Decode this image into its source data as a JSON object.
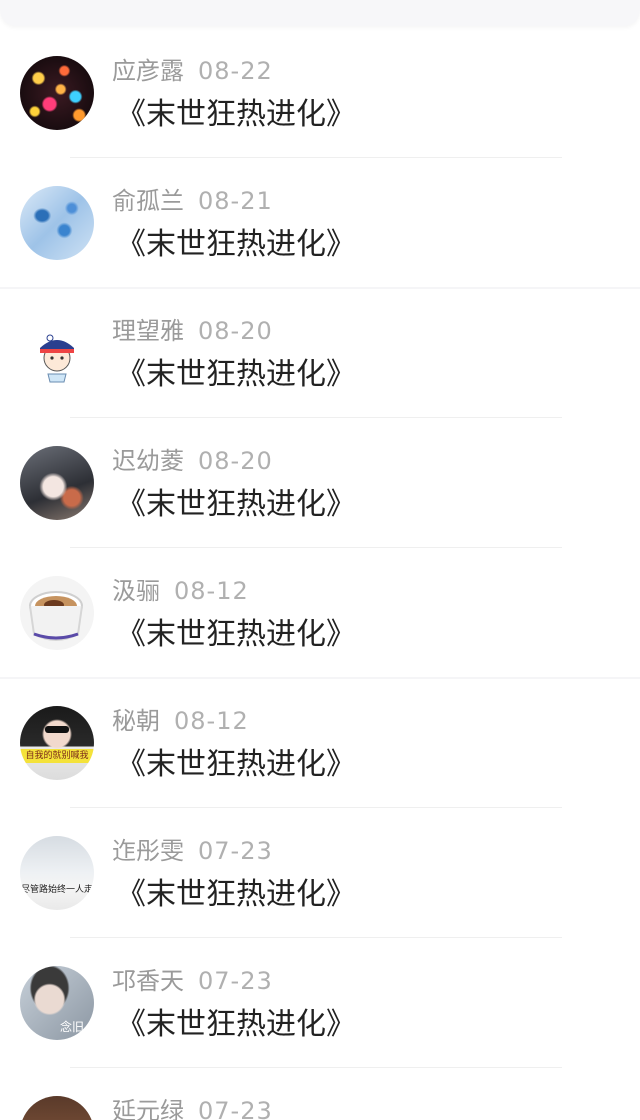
{
  "items": [
    {
      "name": "应彦露",
      "date": "08-22",
      "title": "《末世狂热进化》",
      "avatar": "bokeh-lights-avatar"
    },
    {
      "name": "俞孤兰",
      "date": "08-21",
      "title": "《末世狂热进化》",
      "avatar": "blue-map-avatar"
    },
    {
      "name": "理望雅",
      "date": "08-20",
      "title": "《末世狂热进化》",
      "avatar": "cartoon-character-avatar"
    },
    {
      "name": "迟幼菱",
      "date": "08-20",
      "title": "《末世狂热进化》",
      "avatar": "dancer-photo-avatar"
    },
    {
      "name": "汲骊",
      "date": "08-12",
      "title": "《末世狂热进化》",
      "avatar": "coffee-cup-avatar"
    },
    {
      "name": "秘朝",
      "date": "08-12",
      "title": "《末世狂热进化》",
      "avatar": "girl-sunglasses-avatar",
      "avatar_text": "自我的就别喊我"
    },
    {
      "name": "迮彤雯",
      "date": "07-23",
      "title": "《末世狂热进化》",
      "avatar": "street-photo-avatar",
      "avatar_text": "尽管路始终一人走"
    },
    {
      "name": "邛香天",
      "date": "07-23",
      "title": "《末世狂热进化》",
      "avatar": "portrait-photo-avatar",
      "avatar_text": "念旧"
    },
    {
      "name": "延元绿",
      "date": "07-23",
      "title": "",
      "avatar": "anime-avatar"
    }
  ],
  "colors": {
    "name": "#9a9a9a",
    "date": "#b0b0b0",
    "title": "#222222",
    "accent": "#4a90e2"
  },
  "icons": {
    "back": "chevron-left-icon"
  }
}
